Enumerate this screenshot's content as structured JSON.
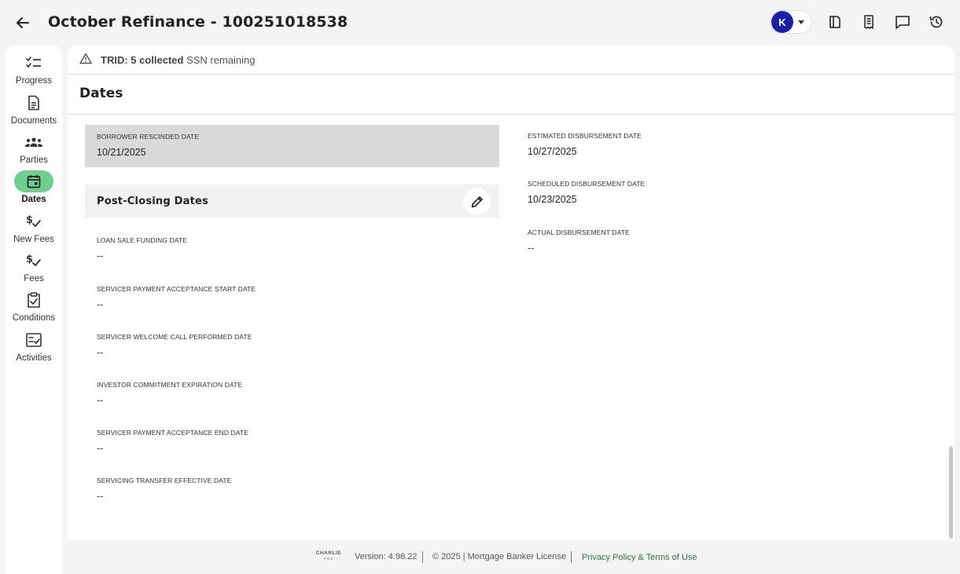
{
  "header": {
    "title": "October Refinance - 100251018538",
    "avatar_initial": "K"
  },
  "sidebar": {
    "items": [
      {
        "label": "Progress",
        "icon": "checklist-icon"
      },
      {
        "label": "Documents",
        "icon": "document-icon"
      },
      {
        "label": "Parties",
        "icon": "people-icon"
      },
      {
        "label": "Dates",
        "icon": "calendar-icon",
        "active": true
      },
      {
        "label": "New Fees",
        "icon": "fee-check-icon"
      },
      {
        "label": "Fees",
        "icon": "fee-check-icon"
      },
      {
        "label": "Conditions",
        "icon": "clipboard-check-icon"
      },
      {
        "label": "Activities",
        "icon": "activity-checklist-icon"
      }
    ]
  },
  "alert": {
    "bold": "TRID: 5 collected",
    "text": " SSN remaining"
  },
  "section": {
    "title": "Dates"
  },
  "borrower_rescinded": {
    "label": "BORROWER RESCINDED DATE",
    "value": "10/21/2025"
  },
  "post_closing": {
    "title": "Post-Closing Dates",
    "fields": [
      {
        "label": "LOAN SALE FUNDING DATE",
        "value": "--"
      },
      {
        "label": "SERVICER PAYMENT ACCEPTANCE START DATE",
        "value": "--"
      },
      {
        "label": "SERVICER WELCOME CALL PERFORMED DATE",
        "value": "--"
      },
      {
        "label": "INVESTOR COMMITMENT EXPIRATION DATE",
        "value": "--"
      },
      {
        "label": "SERVICER PAYMENT ACCEPTANCE END DATE",
        "value": "--"
      },
      {
        "label": "SERVICING TRANSFER EFFECTIVE DATE",
        "value": "--"
      }
    ]
  },
  "disbursement": {
    "fields": [
      {
        "label": "ESTIMATED DISBURSEMENT DATE",
        "value": "10/27/2025"
      },
      {
        "label": "SCHEDULED DISBURSEMENT DATE",
        "value": "10/23/2025"
      },
      {
        "label": "ACTUAL DISBURSEMENT DATE",
        "value": "--"
      }
    ]
  },
  "footer": {
    "logo_brand": "CHARLIE",
    "logo_sub": "POS",
    "version": "Version: 4.98.22",
    "copyright": "© 2025 | Mortgage Banker License",
    "privacy": "Privacy Policy & Terms of Use"
  },
  "colors": {
    "accent_green": "#6fcf8e",
    "avatar_blue": "#1a1fa8",
    "link_green": "#1e7b46",
    "highlight_gray": "#d9d9d9"
  }
}
